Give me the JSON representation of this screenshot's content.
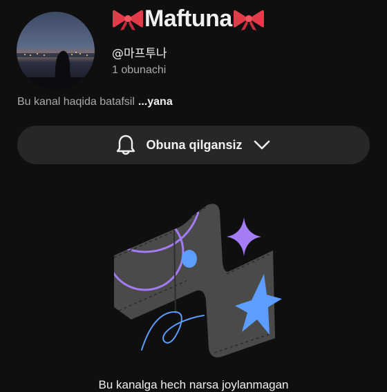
{
  "channel": {
    "name": "Maftuna",
    "handle": "@마프투나",
    "subscribers": "1 obunachi",
    "description": "Bu kanal haqida batafsil",
    "more_label": "...yana"
  },
  "subscribe_button": {
    "label": "Obuna qilgansiz",
    "icons": [
      "bell-icon",
      "chevron-down-icon"
    ]
  },
  "empty_state": {
    "message": "Bu kanalga hech narsa joylanmagan"
  },
  "colors": {
    "background": "#0f0f0f",
    "button_bg": "#272727",
    "secondary_text": "#aaaaaa",
    "illustration_purple": "#a47cf5",
    "illustration_blue": "#5c9dff",
    "bow_red": "#e23b4a"
  }
}
